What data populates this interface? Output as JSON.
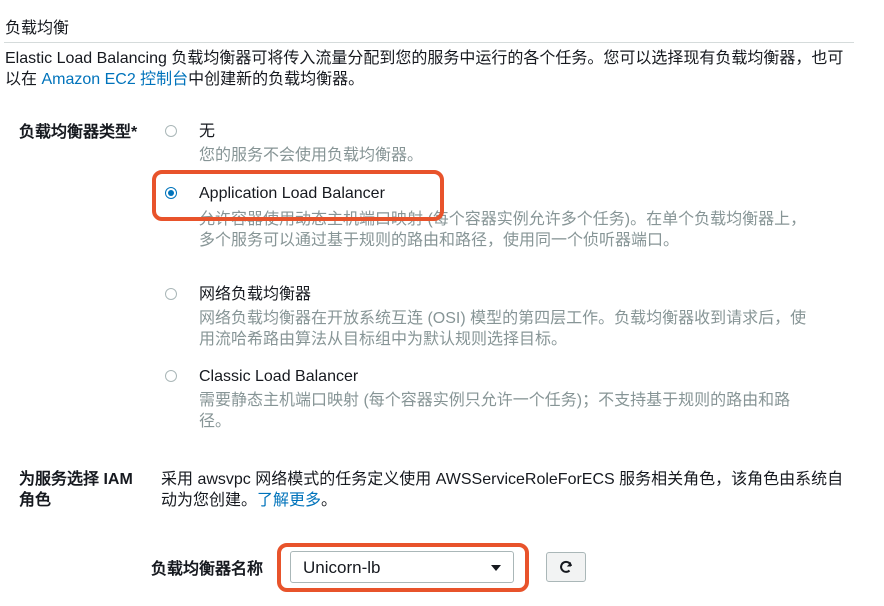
{
  "section": {
    "title": "负载均衡",
    "intro_before_link": "Elastic Load Balancing 负载均衡器可将传入流量分配到您的服务中运行的各个任务。您可以选择现有负载均衡器，也可以在 ",
    "intro_link": "Amazon EC2 控制台",
    "intro_after_link": "中创建新的负载均衡器。"
  },
  "lb_type": {
    "label": "负载均衡器类型*",
    "options": [
      {
        "title": "无",
        "description": "您的服务不会使用负载均衡器。",
        "selected": false
      },
      {
        "title": "Application Load Balancer",
        "description": "允许容器使用动态主机端口映射 (每个容器实例允许多个任务)。在单个负载均衡器上，多个服务可以通过基于规则的路由和路径，使用同一个侦听器端口。",
        "selected": true
      },
      {
        "title": "网络负载均衡器",
        "description": "网络负载均衡器在开放系统互连 (OSI) 模型的第四层工作。负载均衡器收到请求后，使用流哈希路由算法从目标组中为默认规则选择目标。",
        "selected": false
      },
      {
        "title": "Classic Load Balancer",
        "description": "需要静态主机端口映射 (每个容器实例只允许一个任务)；不支持基于规则的路由和路径。",
        "selected": false
      }
    ]
  },
  "iam": {
    "label": "为服务选择 IAM 角色",
    "text": "采用 awsvpc 网络模式的任务定义使用 AWSServiceRoleForECS 服务相关角色，该角色由系统自动为您创建。",
    "link": "了解更多",
    "text_end": "。"
  },
  "lb_name": {
    "label": "负载均衡器名称",
    "selected_value": "Unicorn-lb",
    "refresh_icon": "refresh-icon"
  },
  "colors": {
    "link": "#0073bb",
    "highlight": "#e8532b",
    "muted_text": "#879596"
  }
}
